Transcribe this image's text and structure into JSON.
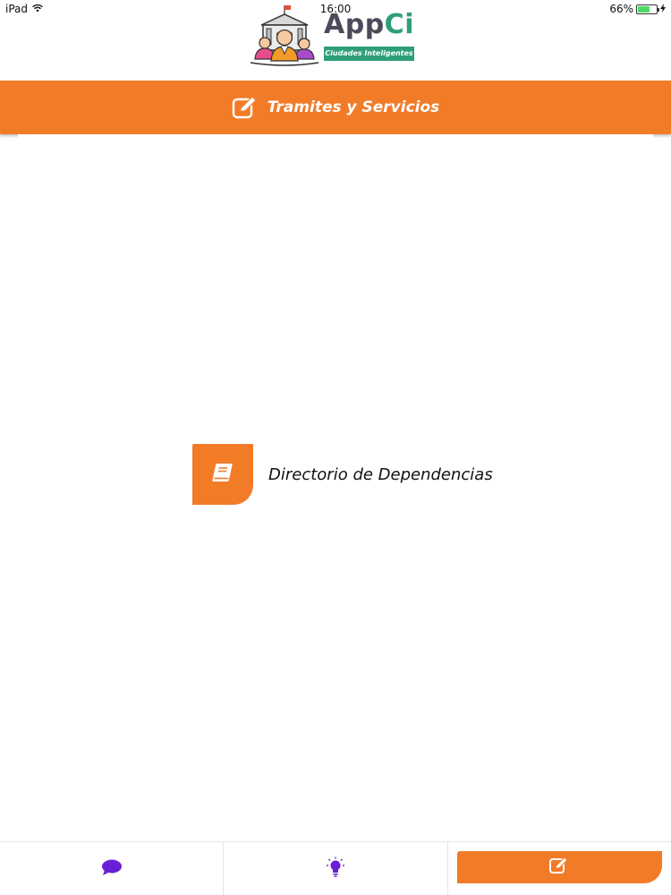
{
  "status_bar": {
    "device": "iPad",
    "time": "16:00",
    "battery": "66%",
    "battery_level": 0.66
  },
  "logo": {
    "word_part1": "App",
    "word_part2": "Ci",
    "tagline": "Ciudades Inteligentes"
  },
  "header": {
    "title": "Tramites y Servicios",
    "icon": "edit-icon"
  },
  "directory_item": {
    "label": "Directorio de Dependencias",
    "icon": "book-icon"
  },
  "tabs": [
    {
      "icon": "chat-bubble-icon",
      "active": false
    },
    {
      "icon": "lightbulb-icon",
      "active": false
    },
    {
      "icon": "edit-icon",
      "active": true
    }
  ],
  "colors": {
    "accent": "#f27b28",
    "brand_green": "#2e9e7a",
    "tab_purple": "#6a1fd6"
  }
}
